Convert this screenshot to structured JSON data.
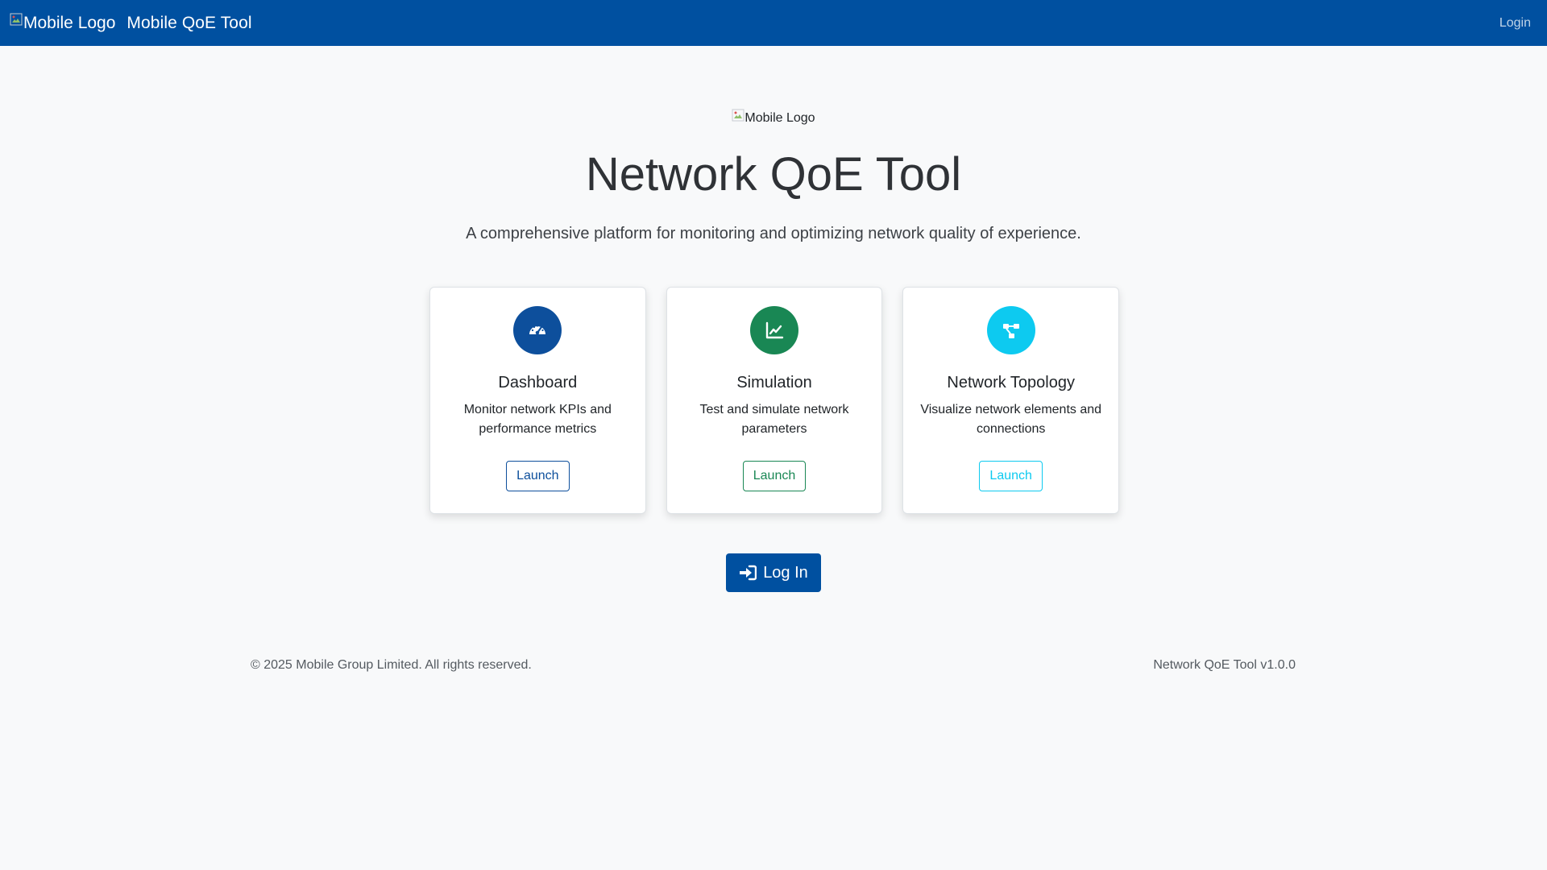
{
  "navbar": {
    "logo_alt": "Mobile Logo",
    "title": "Mobile QoE Tool",
    "login_label": "Login",
    "background_color": "#0050a0"
  },
  "hero": {
    "logo_alt": "Mobile Logo",
    "title": "Network QoE Tool",
    "subtitle": "A comprehensive platform for monitoring and optimizing network quality of experience."
  },
  "cards": [
    {
      "icon": "speedometer-icon",
      "color": "#0d4f9c",
      "title": "Dashboard",
      "description": "Monitor network KPIs and performance metrics",
      "button_label": "Launch"
    },
    {
      "icon": "line-chart-icon",
      "color": "#198754",
      "title": "Simulation",
      "description": "Test and simulate network parameters",
      "button_label": "Launch"
    },
    {
      "icon": "diagram-icon",
      "color": "#0dcaf0",
      "title": "Network Topology",
      "description": "Visualize network elements and connections",
      "button_label": "Launch"
    }
  ],
  "login_button": {
    "icon": "sign-in-icon",
    "label": "Log In"
  },
  "footer": {
    "copyright": "© 2025 Mobile Group Limited. All rights reserved.",
    "version": "Network QoE Tool v1.0.0"
  }
}
